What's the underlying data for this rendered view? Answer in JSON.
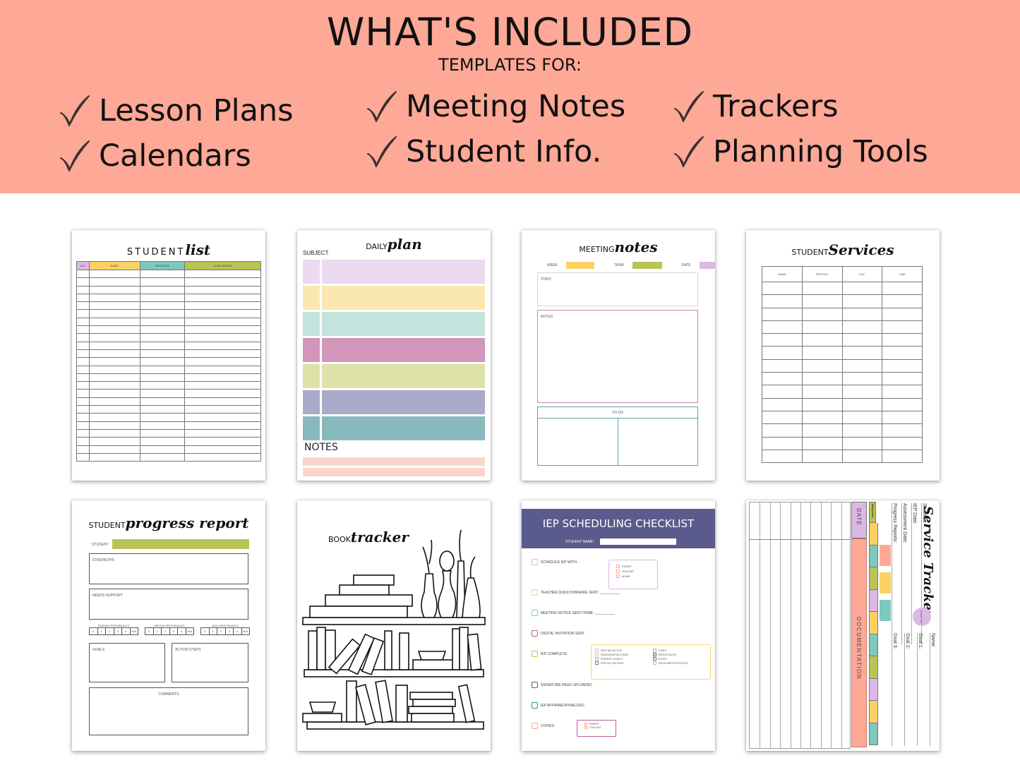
{
  "banner": {
    "title": "WHAT'S INCLUDED",
    "subtitle": "TEMPLATES FOR:",
    "background_color": "#fea897",
    "features": [
      {
        "label": "Lesson Plans",
        "icon": "checkmark-icon"
      },
      {
        "label": "Calendars",
        "icon": "checkmark-icon"
      },
      {
        "label": "Meeting Notes",
        "icon": "checkmark-icon"
      },
      {
        "label": "Student Info.",
        "icon": "checkmark-icon"
      },
      {
        "label": "Trackers",
        "icon": "checkmark-icon"
      },
      {
        "label": "Planning Tools",
        "icon": "checkmark-icon"
      }
    ]
  },
  "templates": {
    "student_list": {
      "title_print": "STUDENT",
      "title_script": "list",
      "columns": [
        {
          "label": "NO.",
          "color": "#dcb8e4"
        },
        {
          "label": "NAME",
          "color": "#fbd164"
        },
        {
          "label": "SERVICES",
          "color": "#7ec8bc"
        },
        {
          "label": "GOAL AREAS",
          "color": "#bac454"
        }
      ],
      "row_count": 24
    },
    "daily_plan": {
      "title_print": "DAILY",
      "title_script": "plan",
      "subject_label": "SUBJECT",
      "row_colors": [
        "#ecdaf0",
        "#fbe8b0",
        "#c3e3dc",
        "#d196b9",
        "#dde2a8",
        "#aaabc8",
        "#88b9bc"
      ],
      "notes_label": "NOTES",
      "notes_color": "#fdd4cd"
    },
    "meeting_notes": {
      "title_print": "MEETING",
      "title_script": "notes",
      "fields": [
        {
          "label": "WEEK",
          "color": "#fbd164"
        },
        {
          "label": "TEAM",
          "color": "#bac454"
        },
        {
          "label": "DATE",
          "color": "#dcb8e4"
        }
      ],
      "topic_label": "TOPIC",
      "notes_label": "NOTES",
      "todo_label": "TO DO"
    },
    "student_services": {
      "title_print": "STUDENT",
      "title_script": "Services",
      "columns": [
        "NAME",
        "SERVICE",
        "DAY",
        "TIME"
      ],
      "row_count": 14
    },
    "progress_report": {
      "title_print": "STUDENT",
      "title_script": "progress report",
      "student_label": "STUDENT",
      "strengths_label": "STRENGTHS",
      "needs_label": "NEEDS SUPPORT",
      "scales": [
        {
          "label": "READING PERFORMANCE",
          "values": [
            "0",
            "1",
            "2",
            "3",
            "4",
            "N/A"
          ]
        },
        {
          "label": "WRITING PERFORMANCE",
          "values": [
            "0",
            "1",
            "2",
            "3",
            "4",
            "N/A"
          ]
        },
        {
          "label": "MATH PERFORMANCE",
          "values": [
            "0",
            "1",
            "2",
            "3",
            "4",
            "N/A"
          ]
        }
      ],
      "goals_label": "GOALS",
      "action_label": "ACTION STEPS",
      "comments_label": "COMMENTS"
    },
    "book_tracker": {
      "title_print": "BOOK",
      "title_script": "tracker"
    },
    "iep_checklist": {
      "title": "IEP SCHEDULING CHECKLIST",
      "student_name_label": "STUDENT NAME:",
      "header_color": "#5b5a8c",
      "items": [
        {
          "label": "SCHEDULE IEP WITH:",
          "color": "#dcb8e4"
        },
        {
          "label": "TEACHER QUESTIONNAIRE SENT: __________",
          "color": "#fbd164"
        },
        {
          "label": "MEETING NOTICE SENT HOME: __________",
          "color": "#7ec8bc"
        },
        {
          "label": "DIGITAL INVITATION SENT",
          "color": "#b95d9c"
        },
        {
          "label": "IEP COMPLETE:",
          "color": "#bac454"
        },
        {
          "label": "SIGNATURE PAGE UPLOADED",
          "color": "#5b5a8c"
        },
        {
          "label": "IEP AFFIRMED/FINALIZED",
          "color": "#2e8c90"
        },
        {
          "label": "COPIES:",
          "color": "#fea897"
        }
      ],
      "schedule_with": [
        "PARENT",
        "TEACHER",
        "ADMIN"
      ],
      "iep_complete_parts": [
        {
          "label": "MEETING NOTICE",
          "color": "#dcb8e4"
        },
        {
          "label": "DEMOGRAPHICS PAGE",
          "color": "#fbd164"
        },
        {
          "label": "PRESENT LEVELS",
          "color": "#7ec8bc"
        },
        {
          "label": "SPECIAL FACTORS",
          "color": "#b95d9c"
        },
        {
          "label": "GOALS",
          "color": "#bac454"
        },
        {
          "label": "SERVICES/LRE",
          "color": "#5b5a8c"
        },
        {
          "label": "NOTES",
          "color": "#2e8c90"
        },
        {
          "label": "PRIOR WRITTEN NOTICE",
          "color": "#fea897"
        }
      ],
      "copies": [
        "PARENT",
        "CUM FILE"
      ]
    },
    "service_tracker": {
      "title_script": "Service Tracker",
      "fields_left": [
        "Services:",
        "IEP Date:",
        "Assessment Date:",
        "Progress Reports:"
      ],
      "fields_right": [
        "Name:",
        "Goal 1:",
        "Goal 2:",
        "Goal 3:"
      ],
      "badge_label": "School Year",
      "billing_label": "Billing Dates",
      "date_label": "DATE",
      "documentation_label": "DOCUMENTATION",
      "strip_colors": [
        "#bac454",
        "#fbd164",
        "#7ec8bc",
        "#bac454",
        "#dcb8e4",
        "#fbd164",
        "#7ec8bc",
        "#bac454",
        "#dcb8e4",
        "#fbd164",
        "#7ec8bc"
      ],
      "report_colors": [
        "#fea897",
        "#fbd164",
        "#7ec8bc"
      ]
    }
  }
}
